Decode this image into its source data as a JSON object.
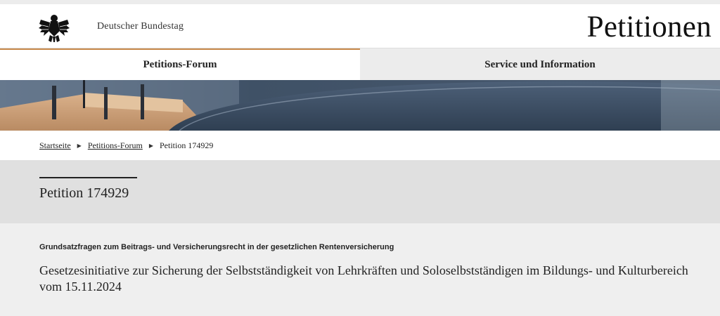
{
  "header": {
    "org_name": "Deutscher Bundestag",
    "site_title": "Petitionen",
    "logo_icon": "federal-eagle-icon"
  },
  "nav": {
    "tabs": [
      {
        "label": "Petitions-Forum",
        "active": true
      },
      {
        "label": "Service und Information",
        "active": false
      }
    ]
  },
  "breadcrumb": {
    "items": [
      "Startseite",
      "Petitions-Forum",
      "Petition 174929"
    ]
  },
  "petition": {
    "title": "Petition 174929",
    "category": "Grundsatzfragen zum Beitrags- und Versicherungsrecht in der gesetzlichen Rentenversicherung",
    "subject": "Gesetzesinitiative zur Sicherung der Selbstständigkeit von Lehrkräften und Soloselbstständigen im Bildungs- und Kulturbereich vom 15.11.2024"
  },
  "colors": {
    "accent": "#c8894a",
    "inactive_tab": "#ececec",
    "title_band": "#e0e0e0",
    "content_bg": "#efefef"
  }
}
